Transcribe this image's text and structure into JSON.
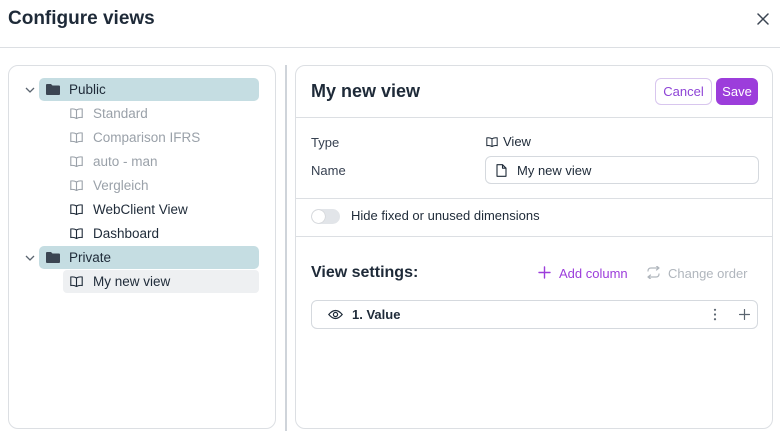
{
  "dialog": {
    "title": "Configure views"
  },
  "tree": {
    "public": {
      "label": "Public",
      "items": [
        {
          "label": "Standard",
          "muted": true
        },
        {
          "label": "Comparison IFRS",
          "muted": true
        },
        {
          "label": "auto - man",
          "muted": true
        },
        {
          "label": "Vergleich",
          "muted": true
        },
        {
          "label": "WebClient View",
          "muted": false
        },
        {
          "label": "Dashboard",
          "muted": false
        }
      ]
    },
    "private": {
      "label": "Private",
      "items": [
        {
          "label": "My new view",
          "muted": false,
          "selected": true
        }
      ]
    }
  },
  "editor": {
    "title": "My new view",
    "cancel_label": "Cancel",
    "save_label": "Save",
    "type_label": "Type",
    "type_value": "View",
    "name_label": "Name",
    "name_value": "My new view",
    "toggle_label": "Hide fixed or unused dimensions",
    "toggle_on": false,
    "view_settings_title": "View settings:",
    "add_column_label": "Add column",
    "change_order_label": "Change order",
    "columns": [
      {
        "label": "1. Value",
        "visible": true
      }
    ]
  },
  "colors": {
    "accent": "#9c3ddb",
    "folder_highlight": "#c5dde2",
    "muted_text": "#9aa1a9"
  }
}
